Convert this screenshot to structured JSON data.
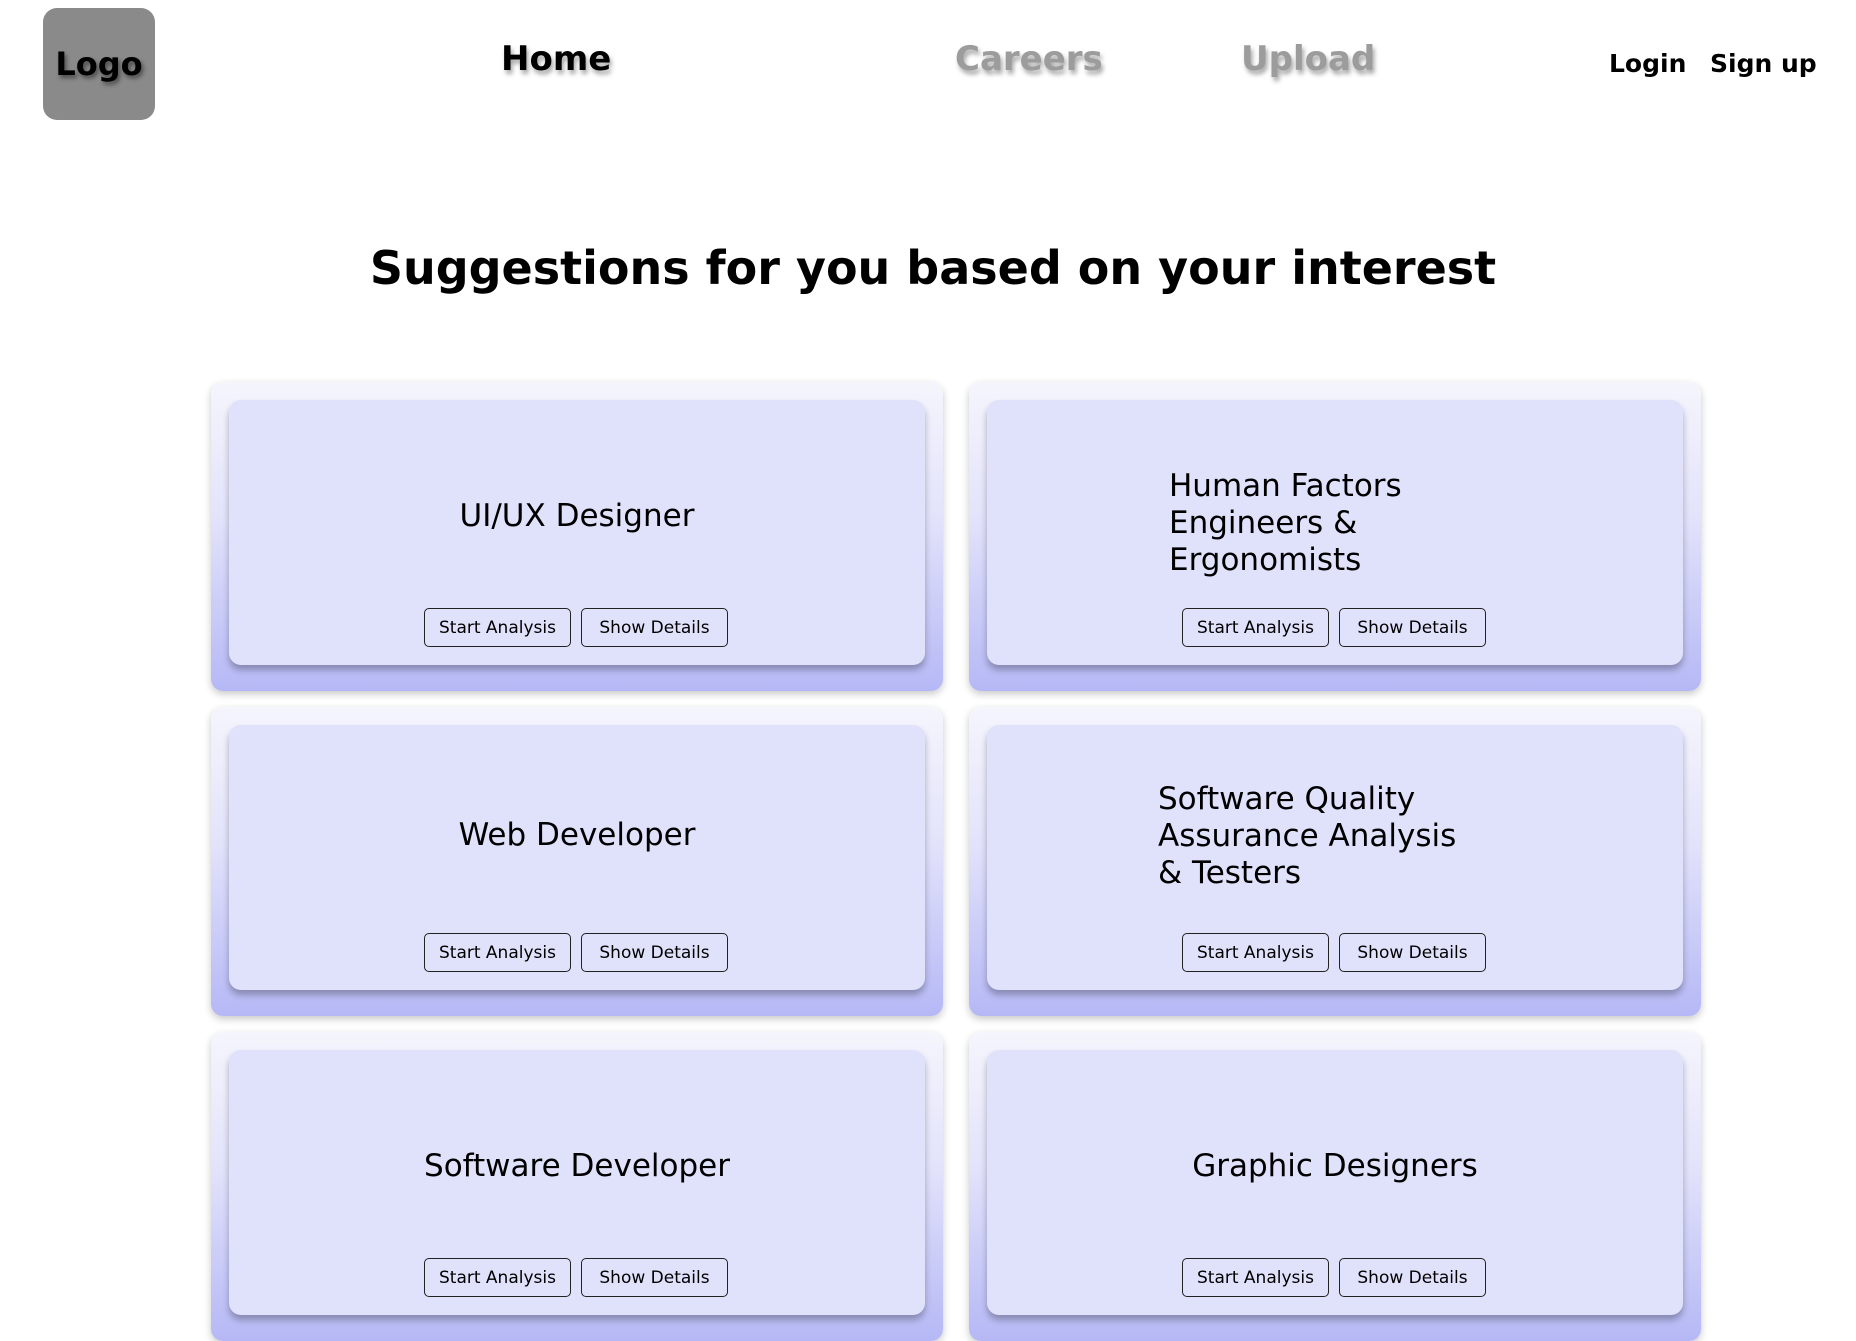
{
  "header": {
    "logo": "Logo",
    "nav": {
      "home": "Home",
      "careers": "Careers",
      "upload": "Upload"
    },
    "auth": {
      "login": "Login",
      "signup": "Sign up"
    }
  },
  "main": {
    "title": "Suggestions for you based on your interest",
    "cards": [
      {
        "title": "UI/UX Designer",
        "start_label": "Start Analysis",
        "details_label": "Show Details"
      },
      {
        "title": "Human Factors Engineers & Ergonomists",
        "start_label": "Start Analysis",
        "details_label": "Show Details"
      },
      {
        "title": "Web Developer",
        "start_label": "Start Analysis",
        "details_label": "Show Details"
      },
      {
        "title": "Software Quality Assurance Analysis & Testers",
        "start_label": "Start Analysis",
        "details_label": "Show Details"
      },
      {
        "title": "Software Developer",
        "start_label": "Start Analysis",
        "details_label": "Show Details"
      },
      {
        "title": "Graphic Designers",
        "start_label": "Start Analysis",
        "details_label": "Show Details"
      }
    ]
  },
  "colors": {
    "card_fill": "#e0e1fb",
    "card_gradient_bottom": "#b5b8f5",
    "inactive_nav": "#9c9c9c",
    "logo_bg": "#8a8a8a"
  }
}
